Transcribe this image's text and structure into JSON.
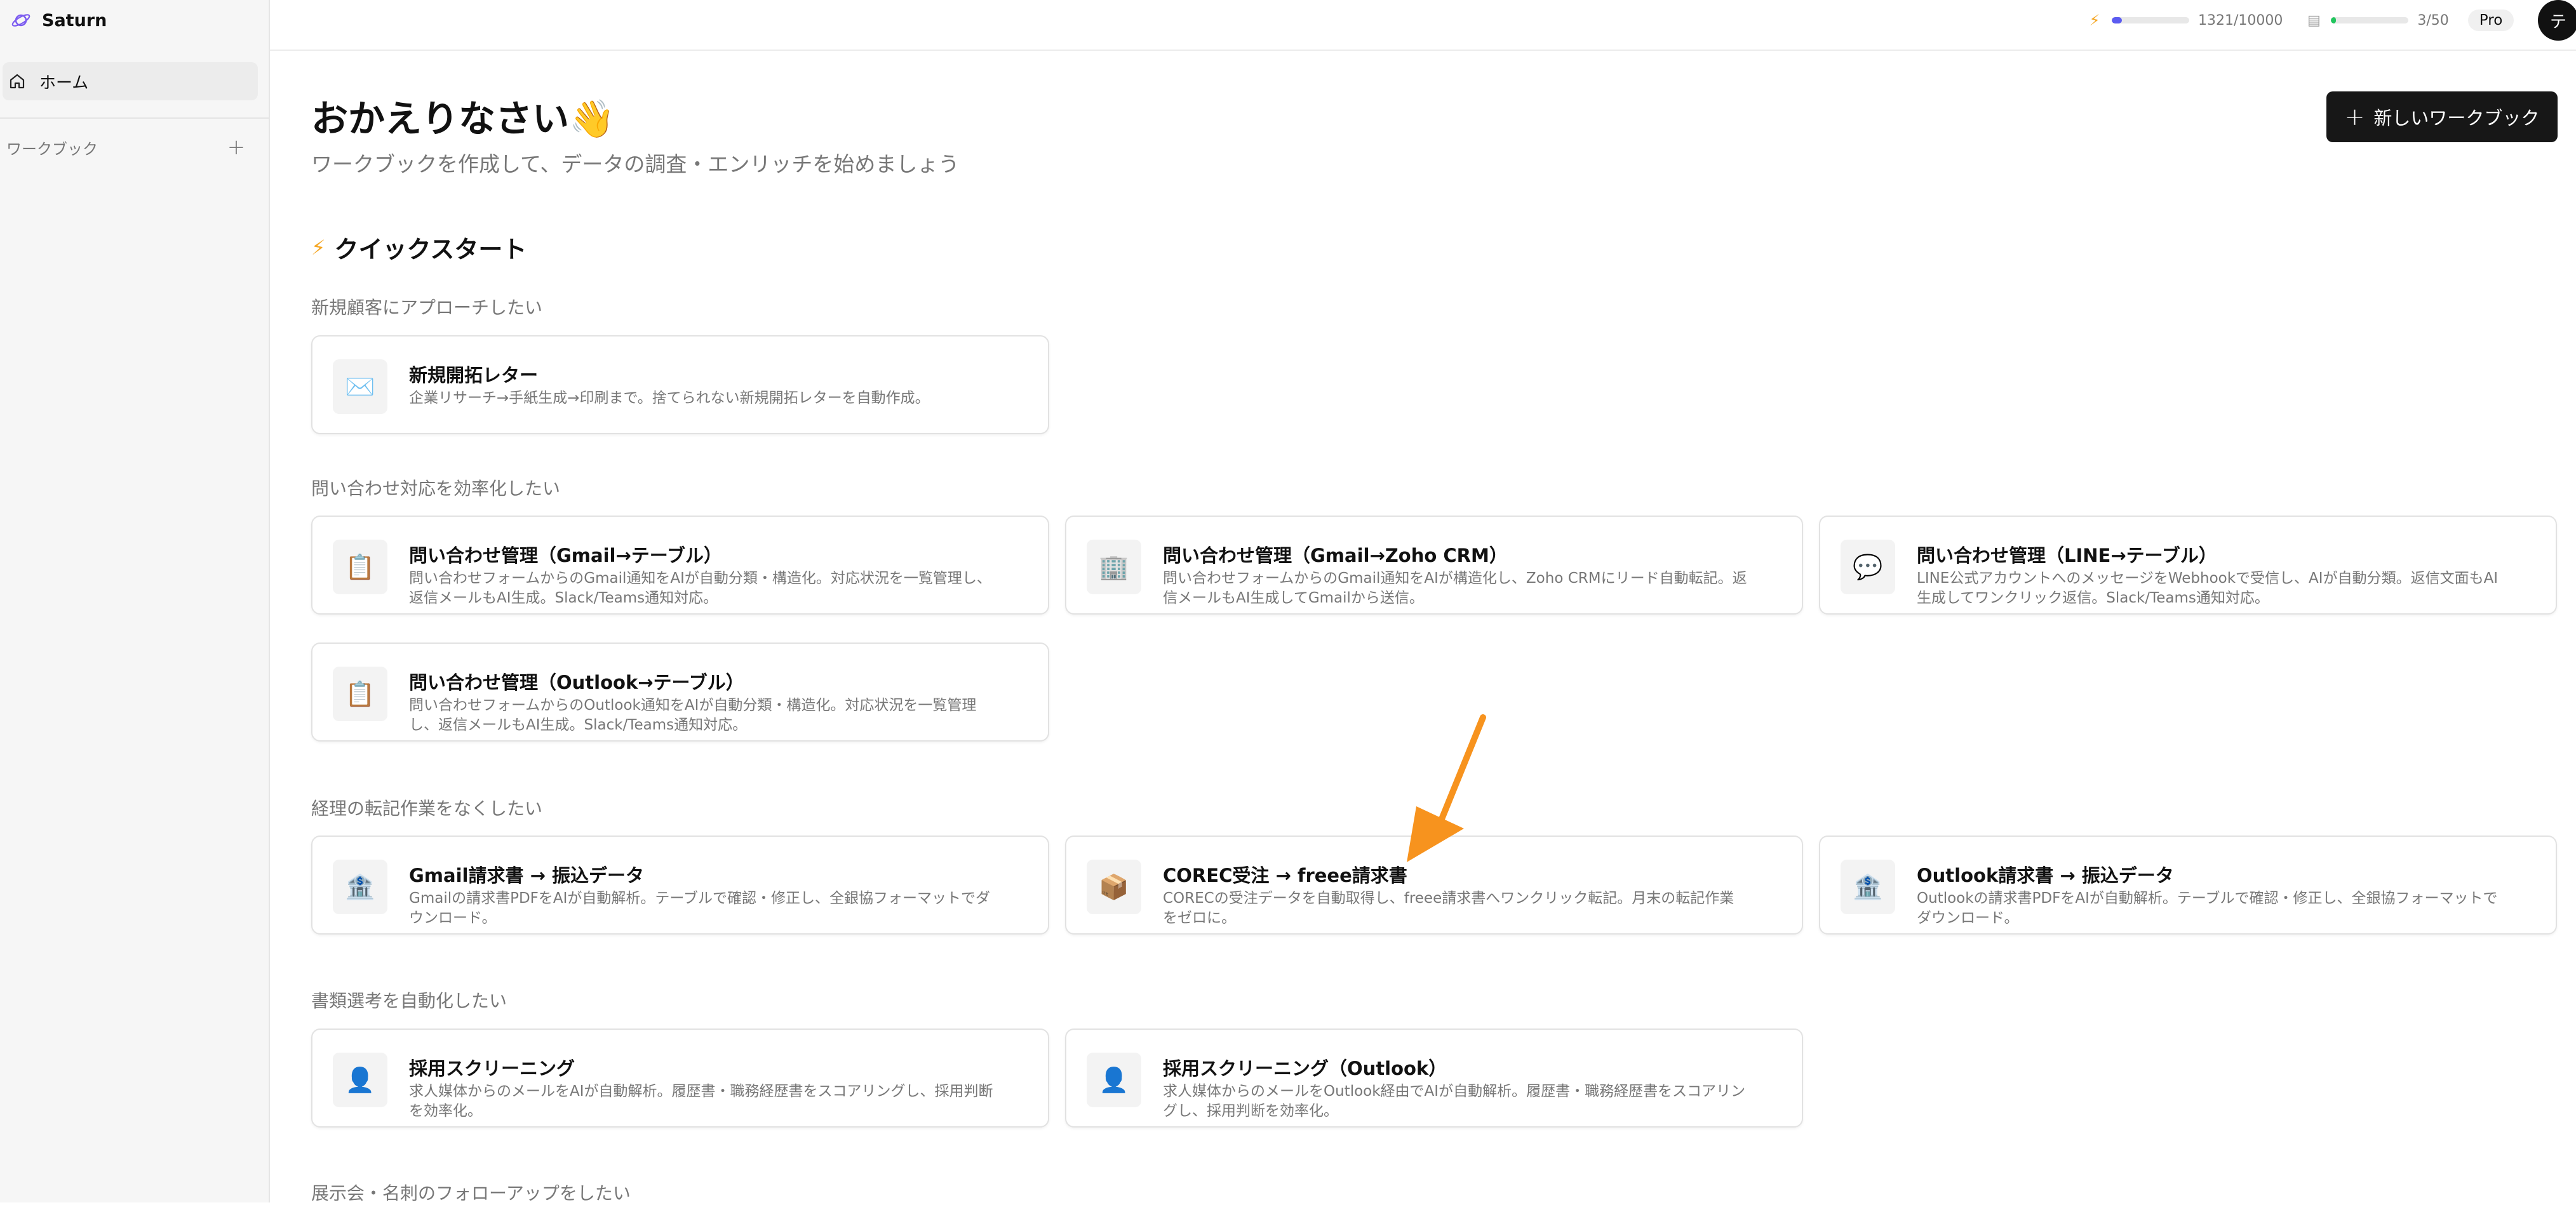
{
  "sidebar": {
    "brand": "Saturn",
    "home_label": "ホーム",
    "workbook_label": "ワークブック",
    "add_symbol": "+"
  },
  "topbar": {
    "credits_text": "1321/10000",
    "credits_fraction": 0.1321,
    "sheets_text": "3/50",
    "sheets_fraction": 0.06,
    "plan": "Pro",
    "avatar_initial": "テ"
  },
  "main": {
    "welcome": "おかえりなさい👋",
    "subtitle": "ワークブックを作成して、データの調査・エンリッチを始めましょう",
    "new_workbook_label": "新しいワークブック",
    "quickstart_title": "クイックスタート",
    "sections": [
      {
        "label": "新規顧客にアプローチしたい",
        "cards": [
          {
            "icon": "✉️",
            "title": "新規開拓レター",
            "desc": "企業リサーチ→手紙生成→印刷まで。捨てられない新規開拓レターを自動作成。"
          }
        ]
      },
      {
        "label": "問い合わせ対応を効率化したい",
        "cards": [
          {
            "icon": "📋",
            "title": "問い合わせ管理（Gmail→テーブル）",
            "desc": "問い合わせフォームからのGmail通知をAIが自動分類・構造化。対応状況を一覧管理し、返信メールもAI生成。Slack/Teams通知対応。"
          },
          {
            "icon": "🏢",
            "title": "問い合わせ管理（Gmail→Zoho CRM）",
            "desc": "問い合わせフォームからのGmail通知をAIが構造化し、Zoho CRMにリード自動転記。返信メールもAI生成してGmailから送信。"
          },
          {
            "icon": "💬",
            "title": "問い合わせ管理（LINE→テーブル）",
            "desc": "LINE公式アカウントへのメッセージをWebhookで受信し、AIが自動分類。返信文面もAI生成してワンクリック返信。Slack/Teams通知対応。"
          },
          {
            "icon": "📋",
            "title": "問い合わせ管理（Outlook→テーブル）",
            "desc": "問い合わせフォームからのOutlook通知をAIが自動分類・構造化。対応状況を一覧管理し、返信メールもAI生成。Slack/Teams通知対応。"
          }
        ]
      },
      {
        "label": "経理の転記作業をなくしたい",
        "cards": [
          {
            "icon": "🏦",
            "title": "Gmail請求書 → 振込データ",
            "desc": "Gmailの請求書PDFをAIが自動解析。テーブルで確認・修正し、全銀協フォーマットでダウンロード。"
          },
          {
            "icon": "📦",
            "title": "COREC受注 → freee請求書",
            "desc": "CORECの受注データを自動取得し、freee請求書へワンクリック転記。月末の転記作業をゼロに。"
          },
          {
            "icon": "🏦",
            "title": "Outlook請求書 → 振込データ",
            "desc": "Outlookの請求書PDFをAIが自動解析。テーブルで確認・修正し、全銀協フォーマットでダウンロード。"
          }
        ]
      },
      {
        "label": "書類選考を自動化したい",
        "cards": [
          {
            "icon": "👤",
            "title": "採用スクリーニング",
            "desc": "求人媒体からのメールをAIが自動解析。履歴書・職務経歴書をスコアリングし、採用判断を効率化。"
          },
          {
            "icon": "👤",
            "title": "採用スクリーニング（Outlook）",
            "desc": "求人媒体からのメールをOutlook経由でAIが自動解析。履歴書・職務経歴書をスコアリングし、採用判断を効率化。"
          }
        ]
      },
      {
        "label": "展示会・名刺のフォローアップをしたい",
        "cards": []
      }
    ]
  },
  "colors": {
    "accent_credit": "#5b5bf0",
    "accent_sheet": "#22c55e",
    "arrow": "#f7931e",
    "button_bg": "#171717"
  }
}
